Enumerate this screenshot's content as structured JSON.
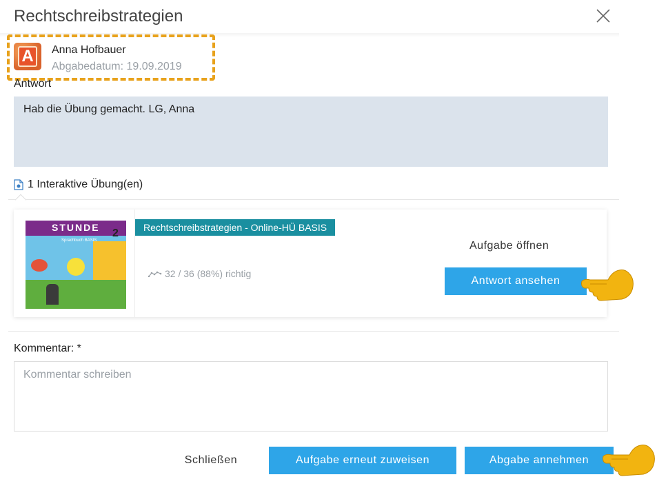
{
  "dialog": {
    "title": "Rechtschreibstrategien",
    "close_icon": "close-icon"
  },
  "submission": {
    "user_name": "Anna Hofbauer",
    "avatar_letter": "A",
    "date_text": "Abgabedatum: 19.09.2019"
  },
  "answer": {
    "label": "Antwort",
    "text": "Hab die Übung gemacht. LG, Anna"
  },
  "exercises": {
    "heading": "1 Interaktive Übung(en)",
    "items": [
      {
        "tag": "Rechtschreibstrategien - Online-HÜ BASIS",
        "cover_title": "STUNDE",
        "cover_number": "2",
        "cover_subtitle": "Sprachbuch BASIS",
        "score": "32 / 36 (88%) richtig",
        "open_label": "Aufgabe öffnen",
        "view_button": "Antwort ansehen"
      }
    ]
  },
  "comment": {
    "label": "Kommentar: *",
    "placeholder": "Kommentar schreiben",
    "value": ""
  },
  "footer": {
    "close_button": "Schließen",
    "reassign_button": "Aufgabe erneut zuweisen",
    "accept_button": "Abgabe annehmen"
  },
  "colors": {
    "accent_blue": "#2ea5e8",
    "tag_teal": "#1a8fa0",
    "highlight_orange": "#e8a21c",
    "answer_bg": "#dbe3ec"
  }
}
